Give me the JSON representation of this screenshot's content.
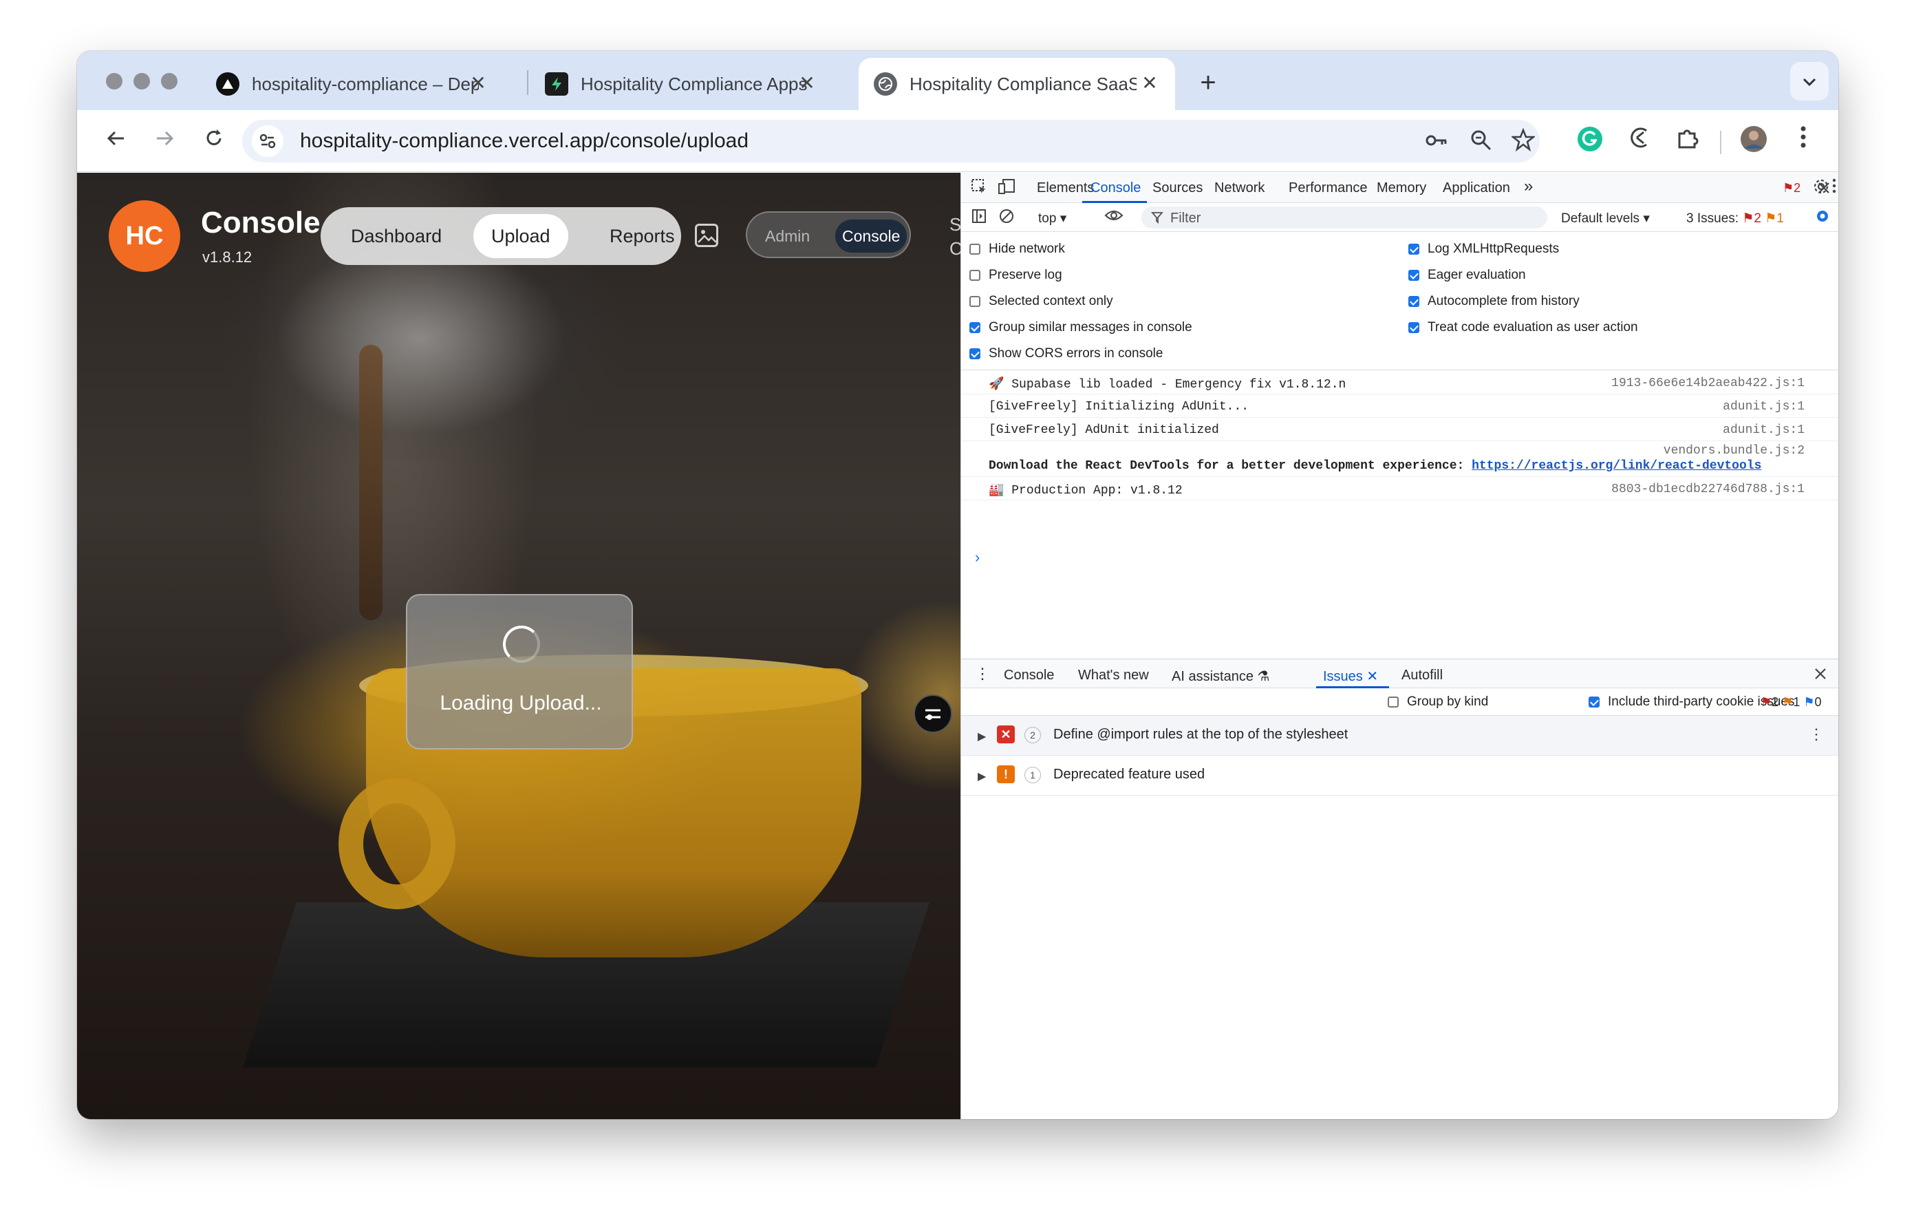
{
  "browser": {
    "tabs": [
      {
        "title": "hospitality-compliance – Dep",
        "favicon": "vercel-icon"
      },
      {
        "title": "Hospitality Compliance Apps",
        "favicon": "supabase-icon"
      },
      {
        "title": "Hospitality Compliance SaaS",
        "favicon": "globe-icon"
      }
    ],
    "new_tab": "+",
    "tab_menu": "⌄",
    "close_glyph": "✕",
    "url": "hospitality-compliance.vercel.app/console/upload"
  },
  "app": {
    "logo": "HC",
    "title": "Console",
    "version": "v1.8.12",
    "nav": {
      "dashboard": "Dashboard",
      "upload": "Upload",
      "reports": "Reports"
    },
    "mode": {
      "admin": "Admin",
      "console": "Console"
    },
    "edge_text": "S\nC",
    "loading_text": "Loading Upload..."
  },
  "devtools": {
    "tabs": {
      "elements": "Elements",
      "console": "Console",
      "sources": "Sources",
      "network": "Network",
      "performance": "Performance",
      "memory": "Memory",
      "application": "Application",
      "more": "»"
    },
    "error_badge": "2",
    "context": "top ▾",
    "filter_placeholder": "Filter",
    "levels": "Default levels ▾",
    "issues_summary": {
      "label": "3 Issues:",
      "errors": "2",
      "warnings": "1"
    },
    "settings": {
      "left": [
        {
          "label": "Hide network",
          "checked": false
        },
        {
          "label": "Preserve log",
          "checked": false
        },
        {
          "label": "Selected context only",
          "checked": false
        },
        {
          "label": "Group similar messages in console",
          "checked": true
        },
        {
          "label": "Show CORS errors in console",
          "checked": true
        }
      ],
      "right": [
        {
          "label": "Log XMLHttpRequests",
          "checked": true
        },
        {
          "label": "Eager evaluation",
          "checked": true
        },
        {
          "label": "Autocomplete from history",
          "checked": true
        },
        {
          "label": "Treat code evaluation as user action",
          "checked": true
        }
      ]
    },
    "logs": [
      {
        "message": "🚀 Supabase lib loaded - Emergency fix v1.8.12.n",
        "source": "1913-66e6e14b2aeab422.js:1"
      },
      {
        "message": "[GiveFreely] Initializing AdUnit...",
        "source": "adunit.js:1"
      },
      {
        "message": "[GiveFreely] AdUnit initialized",
        "source": "adunit.js:1"
      },
      {
        "message": "Download the React DevTools for a better development experience: ",
        "link": "https://reactjs.org/link/react-devtools",
        "source": "vendors.bundle.js:2"
      },
      {
        "message": "🏭 Production App: v1.8.12",
        "source": "8803-db1ecdb22746d788.js:1"
      }
    ],
    "prompt": "›",
    "drawer": {
      "tabs": {
        "console": "Console",
        "whats_new": "What's new",
        "ai": "AI assistance ⚗",
        "issues": "Issues ✕",
        "autofill": "Autofill"
      },
      "group_by_kind": "Group by kind",
      "include_third_party": "Include third-party cookie issues",
      "counts": {
        "errors": "2",
        "warnings": "1",
        "info": "0"
      },
      "issues": [
        {
          "severity": "error",
          "count": "2",
          "title": "Define @import rules at the top of the stylesheet"
        },
        {
          "severity": "warning",
          "count": "1",
          "title": "Deprecated feature used"
        }
      ]
    }
  }
}
